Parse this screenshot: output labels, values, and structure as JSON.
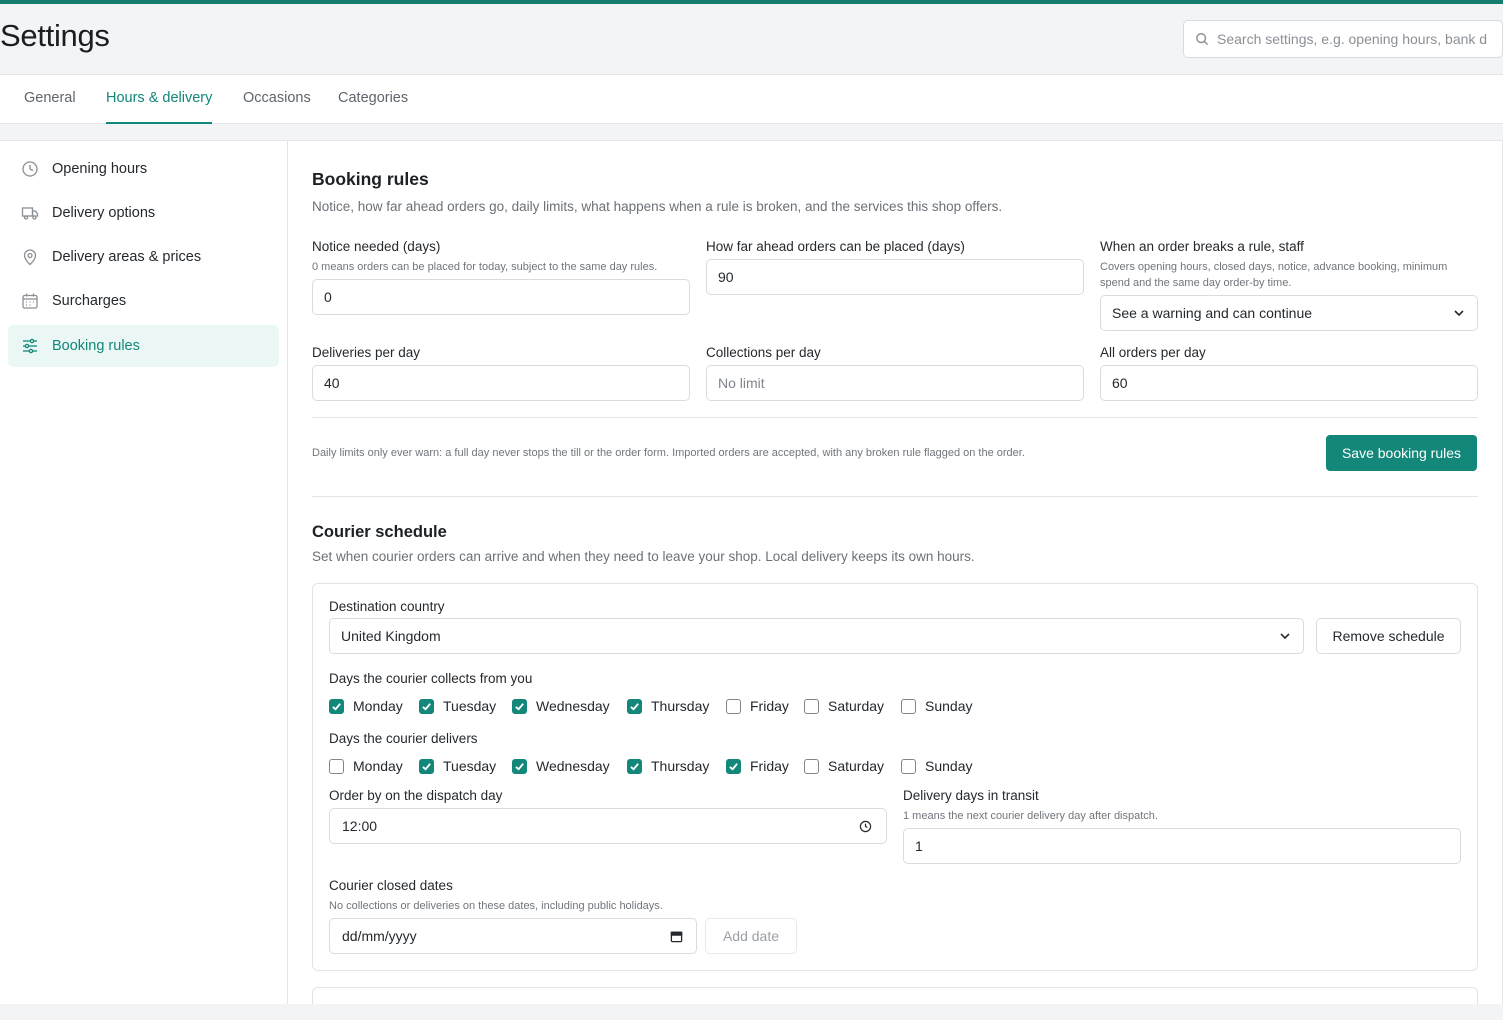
{
  "page": {
    "title": "Settings"
  },
  "search": {
    "placeholder": "Search settings, e.g. opening hours, bank d"
  },
  "tabs": [
    {
      "label": "General"
    },
    {
      "label": "Hours & delivery"
    },
    {
      "label": "Occasions"
    },
    {
      "label": "Categories"
    }
  ],
  "sidebar": {
    "items": [
      {
        "label": "Opening hours",
        "icon": "clock-icon"
      },
      {
        "label": "Delivery options",
        "icon": "truck-icon"
      },
      {
        "label": "Delivery areas & prices",
        "icon": "map-pin-icon"
      },
      {
        "label": "Surcharges",
        "icon": "calendar-icon"
      },
      {
        "label": "Booking rules",
        "icon": "sliders-icon"
      }
    ]
  },
  "booking": {
    "title": "Booking rules",
    "description": "Notice, how far ahead orders go, daily limits, what happens when a rule is broken, and the services this shop offers.",
    "notice_label": "Notice needed (days)",
    "notice_hint": "0 means orders can be placed for today, subject to the same day rules.",
    "notice_value": "0",
    "ahead_label": "How far ahead orders can be placed (days)",
    "ahead_value": "90",
    "breaks_label": "When an order breaks a rule, staff",
    "breaks_hint": "Covers opening hours, closed days, notice, advance booking, minimum spend and the same day order-by time.",
    "breaks_value": "See a warning and can continue",
    "deliveries_label": "Deliveries per day",
    "deliveries_value": "40",
    "collections_label": "Collections per day",
    "collections_placeholder": "No limit",
    "all_label": "All orders per day",
    "all_value": "60",
    "limits_note": "Daily limits only ever warn: a full day never stops the till or the order form. Imported orders are accepted, with any broken rule flagged on the order.",
    "save_label": "Save booking rules"
  },
  "courier": {
    "title": "Courier schedule",
    "description": "Set when courier orders can arrive and when they need to leave your shop. Local delivery keeps its own hours.",
    "country_label": "Destination country",
    "country_value": "United Kingdom",
    "remove_label": "Remove schedule",
    "collects_label": "Days the courier collects from you",
    "collects": [
      {
        "day": "Monday",
        "checked": true
      },
      {
        "day": "Tuesday",
        "checked": true
      },
      {
        "day": "Wednesday",
        "checked": true
      },
      {
        "day": "Thursday",
        "checked": true
      },
      {
        "day": "Friday",
        "checked": false
      },
      {
        "day": "Saturday",
        "checked": false
      },
      {
        "day": "Sunday",
        "checked": false
      }
    ],
    "delivers_label": "Days the courier delivers",
    "delivers": [
      {
        "day": "Monday",
        "checked": false
      },
      {
        "day": "Tuesday",
        "checked": true
      },
      {
        "day": "Wednesday",
        "checked": true
      },
      {
        "day": "Thursday",
        "checked": true
      },
      {
        "day": "Friday",
        "checked": true
      },
      {
        "day": "Saturday",
        "checked": false
      },
      {
        "day": "Sunday",
        "checked": false
      }
    ],
    "orderby_label": "Order by on the dispatch day",
    "orderby_value": "12:00",
    "transit_label": "Delivery days in transit",
    "transit_hint": "1 means the next courier delivery day after dispatch.",
    "transit_value": "1",
    "closed_label": "Courier closed dates",
    "closed_hint": "No collections or deliveries on these dates, including public holidays.",
    "date_placeholder": "dd/mm/yyyy",
    "add_date_label": "Add date"
  },
  "colors": {
    "accent": "#12877a",
    "accent_bg": "#eaf7f4",
    "topbar": "#167c70"
  }
}
